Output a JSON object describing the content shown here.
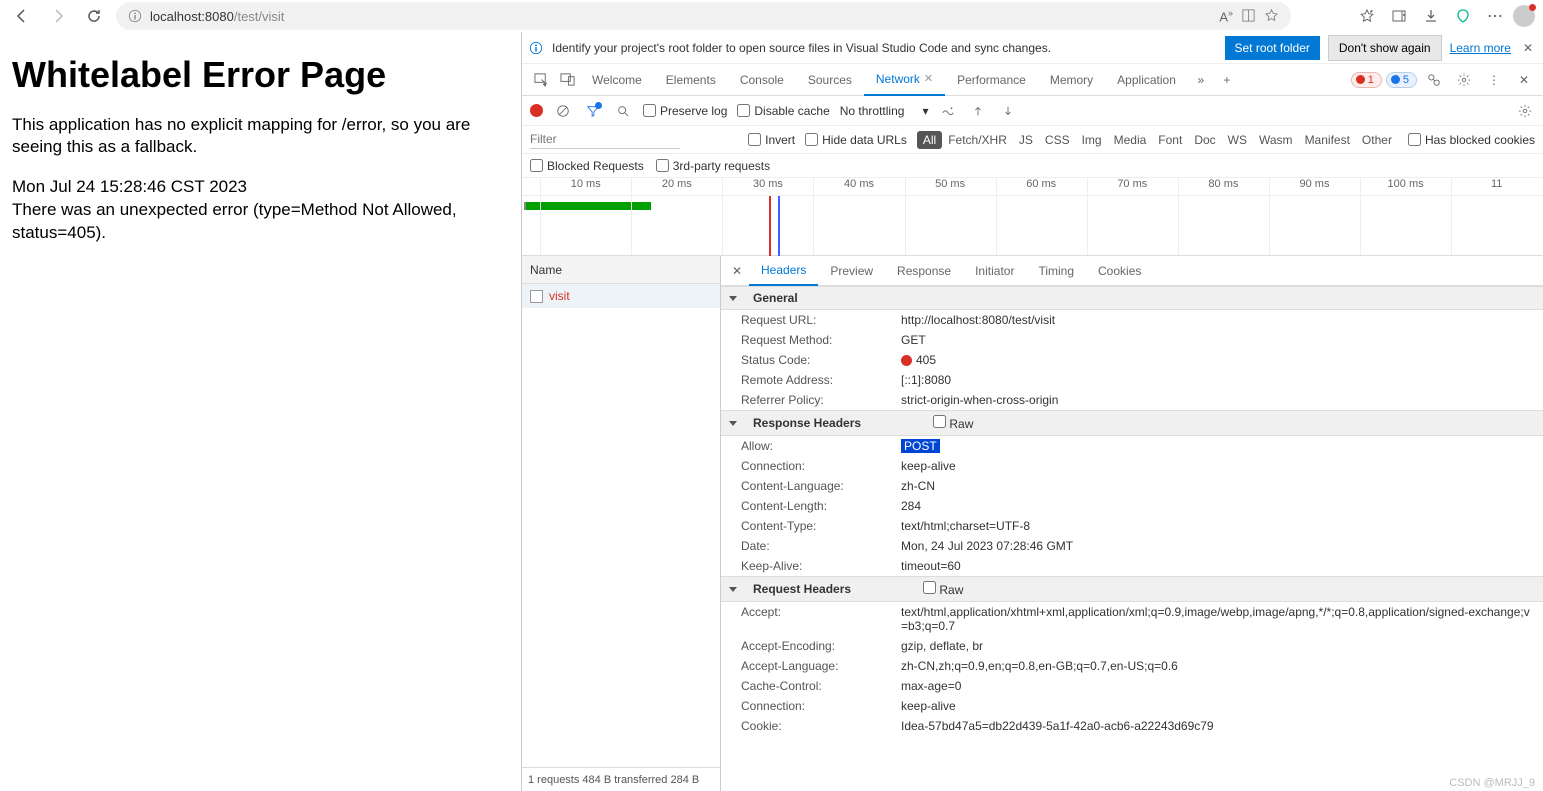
{
  "browser": {
    "url_host": "localhost:",
    "url_port": "8080",
    "url_path": "/test/visit"
  },
  "page": {
    "title": "Whitelabel Error Page",
    "message": "This application has no explicit mapping for /error, so you are seeing this as a fallback.",
    "timestamp": "Mon Jul 24 15:28:46 CST 2023",
    "error_line": "There was an unexpected error (type=Method Not Allowed, status=405)."
  },
  "infobar": {
    "text": "Identify your project's root folder to open source files in Visual Studio Code and sync changes.",
    "btn_primary": "Set root folder",
    "btn_secondary": "Don't show again",
    "learn_more": "Learn more"
  },
  "tabs": {
    "welcome": "Welcome",
    "elements": "Elements",
    "console": "Console",
    "sources": "Sources",
    "network": "Network",
    "performance": "Performance",
    "memory": "Memory",
    "application": "Application",
    "err_count": "1",
    "info_count": "5"
  },
  "net_toolbar": {
    "preserve_log": "Preserve log",
    "disable_cache": "Disable cache",
    "throttling": "No throttling"
  },
  "filter": {
    "placeholder": "Filter",
    "invert": "Invert",
    "hide_data_urls": "Hide data URLs",
    "types": [
      "All",
      "Fetch/XHR",
      "JS",
      "CSS",
      "Img",
      "Media",
      "Font",
      "Doc",
      "WS",
      "Wasm",
      "Manifest",
      "Other"
    ],
    "has_blocked_cookies": "Has blocked cookies",
    "blocked_requests": "Blocked Requests",
    "third_party": "3rd-party requests"
  },
  "timeline_ticks": [
    "10 ms",
    "20 ms",
    "30 ms",
    "40 ms",
    "50 ms",
    "60 ms",
    "70 ms",
    "80 ms",
    "90 ms",
    "100 ms",
    "11"
  ],
  "req_list": {
    "header": "Name",
    "rows": [
      "visit"
    ],
    "status": "1 requests  484 B transferred  284 B"
  },
  "detail_tabs": [
    "Headers",
    "Preview",
    "Response",
    "Initiator",
    "Timing",
    "Cookies"
  ],
  "sections": {
    "general": {
      "title": "General",
      "items": [
        {
          "k": "Request URL:",
          "v": "http://localhost:8080/test/visit"
        },
        {
          "k": "Request Method:",
          "v": "GET"
        },
        {
          "k": "Status Code:",
          "v": "405",
          "status": true
        },
        {
          "k": "Remote Address:",
          "v": "[::1]:8080"
        },
        {
          "k": "Referrer Policy:",
          "v": "strict-origin-when-cross-origin"
        }
      ]
    },
    "response_headers": {
      "title": "Response Headers",
      "raw": "Raw",
      "items": [
        {
          "k": "Allow:",
          "v": "POST",
          "hl": true
        },
        {
          "k": "Connection:",
          "v": "keep-alive"
        },
        {
          "k": "Content-Language:",
          "v": "zh-CN"
        },
        {
          "k": "Content-Length:",
          "v": "284"
        },
        {
          "k": "Content-Type:",
          "v": "text/html;charset=UTF-8"
        },
        {
          "k": "Date:",
          "v": "Mon, 24 Jul 2023 07:28:46 GMT"
        },
        {
          "k": "Keep-Alive:",
          "v": "timeout=60"
        }
      ]
    },
    "request_headers": {
      "title": "Request Headers",
      "raw": "Raw",
      "items": [
        {
          "k": "Accept:",
          "v": "text/html,application/xhtml+xml,application/xml;q=0.9,image/webp,image/apng,*/*;q=0.8,application/signed-exchange;v=b3;q=0.7"
        },
        {
          "k": "Accept-Encoding:",
          "v": "gzip, deflate, br"
        },
        {
          "k": "Accept-Language:",
          "v": "zh-CN,zh;q=0.9,en;q=0.8,en-GB;q=0.7,en-US;q=0.6"
        },
        {
          "k": "Cache-Control:",
          "v": "max-age=0"
        },
        {
          "k": "Connection:",
          "v": "keep-alive"
        },
        {
          "k": "Cookie:",
          "v": "Idea-57bd47a5=db22d439-5a1f-42a0-acb6-a22243d69c79"
        }
      ]
    }
  },
  "watermark": "CSDN @MRJJ_9"
}
